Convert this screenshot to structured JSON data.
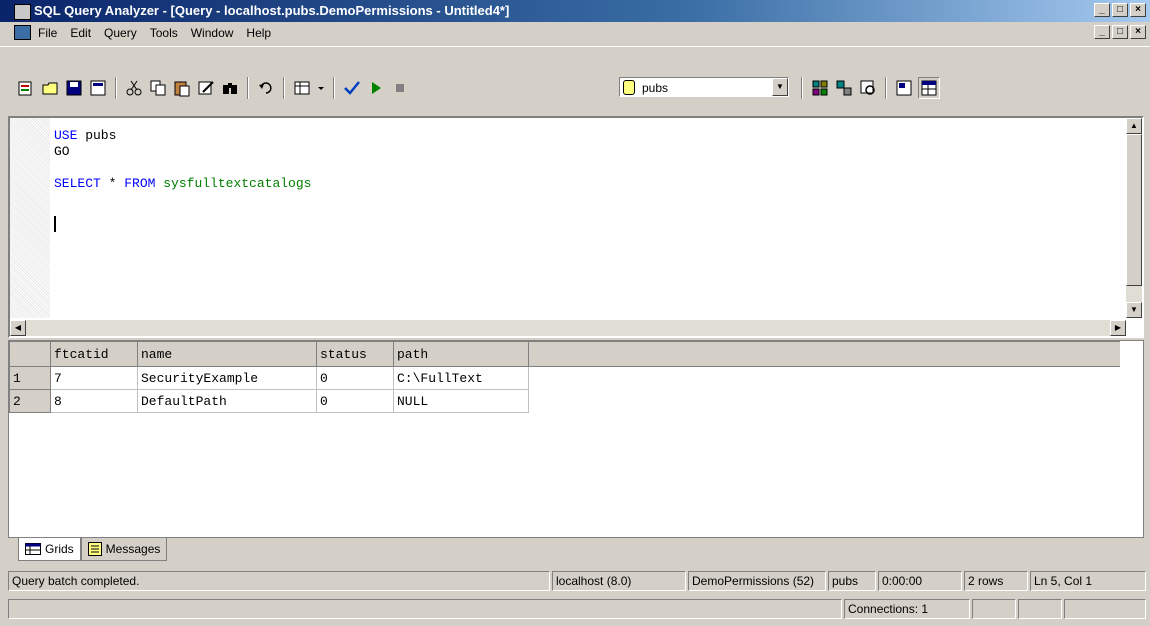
{
  "window": {
    "title": "SQL Query Analyzer - [Query - localhost.pubs.DemoPermissions - Untitled4*]"
  },
  "window_buttons": {
    "minimize": "_",
    "maximize": "□",
    "close": "×"
  },
  "menu": [
    "File",
    "Edit",
    "Query",
    "Tools",
    "Window",
    "Help"
  ],
  "toolbar": {
    "database_value": "pubs"
  },
  "editor": {
    "line1_kw": "USE",
    "line1_rest": " pubs",
    "line2": "GO",
    "line4_kw1": "SELECT",
    "line4_mid": " * ",
    "line4_kw2": "FROM",
    "line4_tbl": " sysfulltextcatalogs"
  },
  "results": {
    "columns": [
      "ftcatid",
      "name",
      "status",
      "path"
    ],
    "rows": [
      {
        "num": "1",
        "ftcatid": "7",
        "name": "SecurityExample",
        "status": "0",
        "path": "C:\\FullText"
      },
      {
        "num": "2",
        "ftcatid": "8",
        "name": "DefaultPath",
        "status": "0",
        "path": "NULL"
      }
    ]
  },
  "tabs": {
    "grids": "Grids",
    "messages": "Messages"
  },
  "status": {
    "message": "Query batch completed.",
    "server": "localhost (8.0)",
    "user": "DemoPermissions (52)",
    "database": "pubs",
    "time": "0:00:00",
    "rows": "2 rows",
    "position": "Ln 5, Col 1",
    "connections": "Connections: 1"
  },
  "icons": [
    "window-icon",
    "new-query-icon",
    "open-icon",
    "save-icon",
    "insert-template-icon",
    "cut-icon",
    "copy-icon",
    "paste-icon",
    "clear-icon",
    "find-icon",
    "undo-icon",
    "execute-mode-icon",
    "parse-icon",
    "execute-icon",
    "stop-icon",
    "database-icon",
    "object-browser-icon",
    "object-search-icon",
    "show-plan-icon",
    "properties-icon",
    "results-grid-icon"
  ]
}
